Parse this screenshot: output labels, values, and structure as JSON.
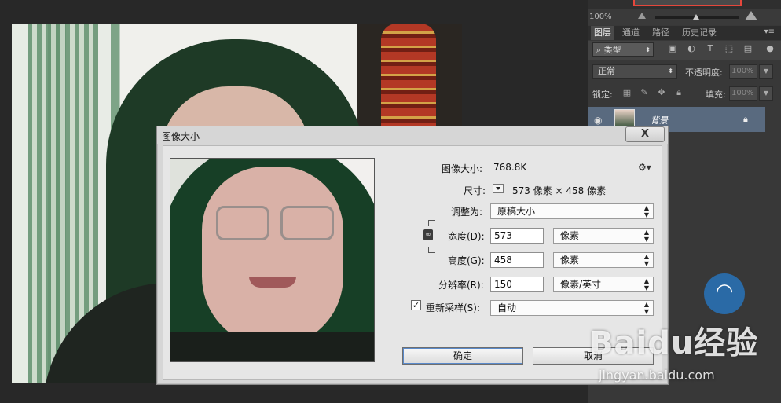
{
  "dialog": {
    "title": "图像大小",
    "close_label": "X",
    "image_size_label": "图像大小:",
    "image_size_value": "768.8K",
    "dimensions_label": "尺寸:",
    "dimensions_value": "573 像素  ×  458 像素",
    "fit_to_label": "调整为:",
    "fit_to_value": "原稿大小",
    "width_label": "宽度(D):",
    "width_value": "573",
    "width_unit": "像素",
    "height_label": "高度(G):",
    "height_value": "458",
    "height_unit": "像素",
    "resolution_label": "分辨率(R):",
    "resolution_value": "150",
    "resolution_unit": "像素/英寸",
    "resample_label": "重新采样(S):",
    "resample_checked": true,
    "resample_value": "自动",
    "ok_label": "确定",
    "cancel_label": "取消"
  },
  "right_panel": {
    "zoom_percent": "100%",
    "tabs": [
      {
        "label": "图层",
        "active": true
      },
      {
        "label": "通道",
        "active": false
      },
      {
        "label": "路径",
        "active": false
      },
      {
        "label": "历史记录",
        "active": false
      }
    ],
    "filter_kind": "类型",
    "blend_mode": "正常",
    "opacity_label": "不透明度:",
    "opacity_value": "100%",
    "lock_label": "锁定:",
    "fill_label": "填充:",
    "fill_value": "100%",
    "layer_name": "背景"
  },
  "watermark": {
    "brand": "Baidu经验",
    "url": "jingyan.baidu.com"
  }
}
